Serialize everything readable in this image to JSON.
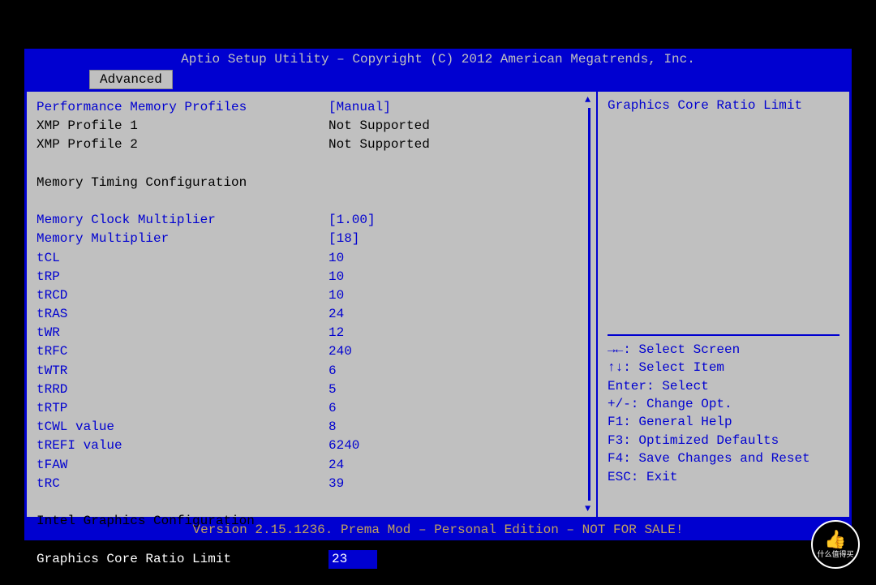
{
  "header": {
    "title": "Aptio Setup Utility – Copyright (C) 2012 American Megatrends, Inc."
  },
  "tab": {
    "label": "Advanced"
  },
  "settings": {
    "perf_profiles": {
      "label": "Performance Memory Profiles",
      "value": "[Manual]"
    },
    "xmp1": {
      "label": "XMP Profile 1",
      "value": "Not Supported"
    },
    "xmp2": {
      "label": "XMP Profile 2",
      "value": "Not Supported"
    },
    "mem_timing_header": "Memory Timing Configuration",
    "mem_clock_mult": {
      "label": "Memory Clock Multiplier",
      "value": "[1.00]"
    },
    "mem_mult": {
      "label": "Memory Multiplier",
      "value": "[18]"
    },
    "tcl": {
      "label": "tCL",
      "value": "10"
    },
    "trp": {
      "label": "tRP",
      "value": "10"
    },
    "trcd": {
      "label": "tRCD",
      "value": "10"
    },
    "tras": {
      "label": "tRAS",
      "value": "24"
    },
    "twr": {
      "label": "tWR",
      "value": "12"
    },
    "trfc": {
      "label": "tRFC",
      "value": "240"
    },
    "twtr": {
      "label": "tWTR",
      "value": "6"
    },
    "trrd": {
      "label": "tRRD",
      "value": "5"
    },
    "trtp": {
      "label": "tRTP",
      "value": "6"
    },
    "tcwl": {
      "label": "tCWL value",
      "value": "8"
    },
    "trefi": {
      "label": "tREFI value",
      "value": "6240"
    },
    "tfaw": {
      "label": "tFAW",
      "value": "24"
    },
    "trc": {
      "label": "tRC",
      "value": "39"
    },
    "intel_gfx_header": "Intel Graphics Configuration",
    "gfx_ratio": {
      "label": "Graphics Core Ratio Limit",
      "value": "23"
    }
  },
  "help": {
    "title": "Graphics Core Ratio Limit",
    "items": [
      "→←: Select Screen",
      "↑↓: Select Item",
      "Enter: Select",
      "+/-: Change Opt.",
      "F1: General Help",
      "F3: Optimized Defaults",
      "F4: Save Changes and Reset",
      "ESC: Exit"
    ]
  },
  "footer": {
    "text": "Version 2.15.1236. Prema Mod – Personal Edition – NOT FOR SALE!"
  },
  "watermark": {
    "text": "什么值得买"
  }
}
